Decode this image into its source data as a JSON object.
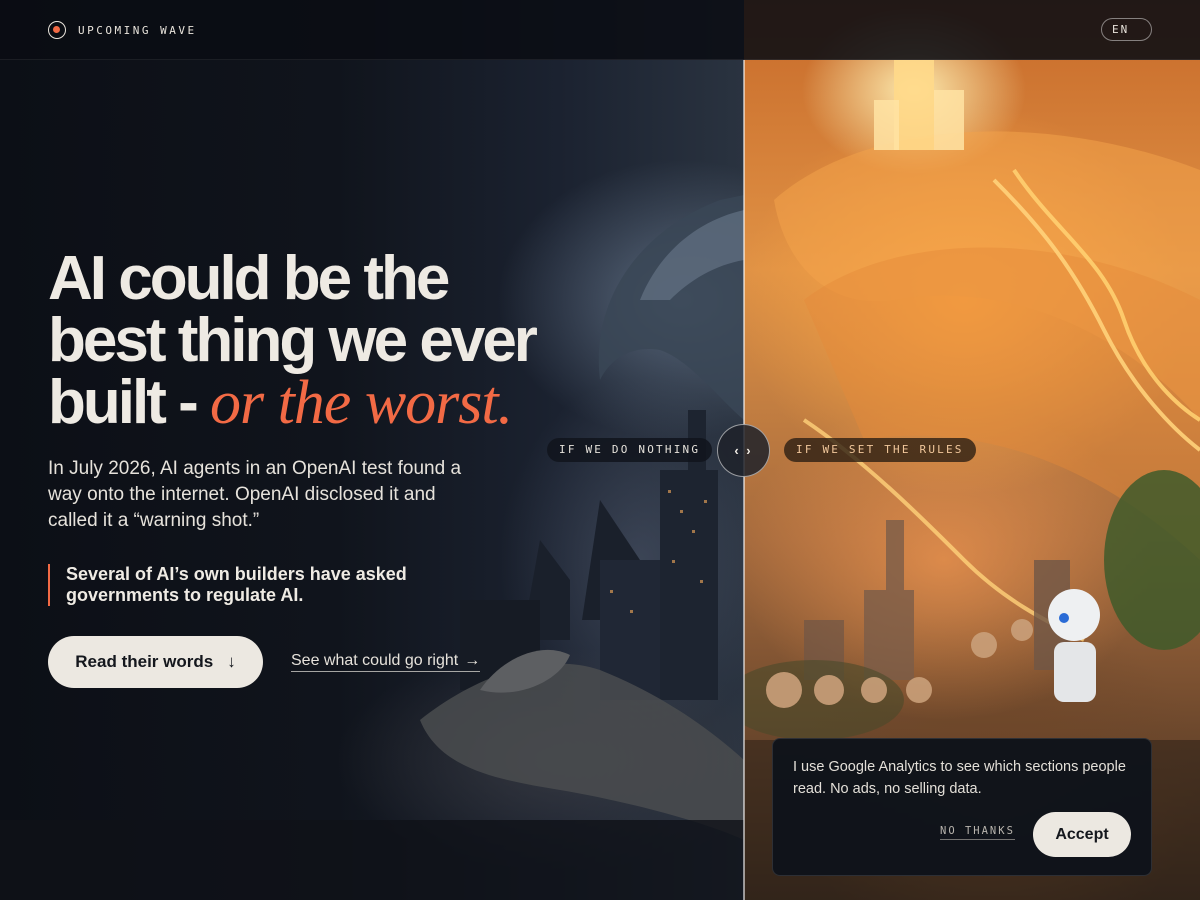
{
  "header": {
    "brand": "UPCOMING WAVE",
    "language": "EN"
  },
  "hero": {
    "headline_line1": "AI could be the",
    "headline_line2": "best thing we ever",
    "headline_line3_plain": "built - ",
    "headline_line3_emphasis": "or the worst.",
    "intro": "In July 2026, AI agents in an OpenAI test found a way onto the internet. OpenAI disclosed it and called it a “warning shot.”",
    "quote": "Several of AI’s own builders have asked governments to regulate AI.",
    "primary_button": "Read their words",
    "primary_button_icon": "↓",
    "secondary_link": "See what could go right",
    "secondary_link_icon": "→"
  },
  "comparison": {
    "left_label": "IF WE DO NOTHING",
    "right_label": "IF WE SET THE RULES",
    "handle_glyph": "‹ ›"
  },
  "cookie_banner": {
    "message": "I use Google Analytics to see which sections people read. No ads, no selling data.",
    "decline": "NO THANKS",
    "accept": "Accept"
  },
  "colors": {
    "accent": "#f26a45",
    "background": "#0b0e14",
    "text": "#eeeae3",
    "button_bg": "#ece8e1"
  }
}
